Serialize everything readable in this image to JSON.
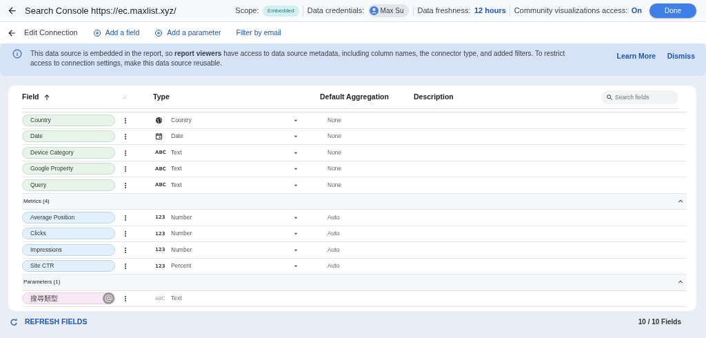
{
  "top_bar": {
    "title": "Search Console https://ec.maxlist.xyz/",
    "scope_label": "Scope:",
    "scope_badge": "Embedded",
    "credentials_label": "Data credentials:",
    "credentials_user": "Max Su",
    "freshness_label": "Data freshness:",
    "freshness_value": "12 hours",
    "community_label": "Community visualizations access:",
    "community_value": "On",
    "done_button": "Done"
  },
  "toolbar": {
    "title": "Edit Connection",
    "actions": [
      {
        "label": "Add a field",
        "kind": "add"
      },
      {
        "label": "Add a parameter",
        "kind": "add"
      },
      {
        "label": "Filter by email",
        "kind": "plain"
      }
    ]
  },
  "banner": {
    "text": "This data source is embedded in the report, so **report viewers** have access to data source metadata, including column names, the connector type, and added filters. To restrict access to connection settings, make this data source reusable.",
    "links": [
      "Learn More",
      "Dismiss"
    ]
  },
  "table": {
    "columns": [
      "Field",
      "Type",
      "Default Aggregation",
      "Description"
    ],
    "search": {
      "placeholder": "Search fields"
    },
    "sections": [
      {
        "kind": "dimension",
        "rows": [
          {
            "name": "Country",
            "type_icon": {
              "kind": "globe"
            },
            "type": "Country",
            "aggregation": "None",
            "editable": true
          },
          {
            "name": "Date",
            "type_icon": {
              "kind": "calendar"
            },
            "type": "Date",
            "aggregation": "None",
            "editable": true
          },
          {
            "name": "Device Category",
            "type_icon": {
              "kind": "label",
              "text": "ABC"
            },
            "type": "Text",
            "aggregation": "None",
            "editable": true
          },
          {
            "name": "Google Property",
            "type_icon": {
              "kind": "label",
              "text": "ABC"
            },
            "type": "Text",
            "aggregation": "None",
            "editable": true
          },
          {
            "name": "Query",
            "type_icon": {
              "kind": "label",
              "text": "ABC"
            },
            "type": "Text",
            "aggregation": "None",
            "editable": true
          }
        ]
      },
      {
        "kind": "metric",
        "header": "Metrics (4)",
        "expanded": true,
        "rows": [
          {
            "name": "Average Position",
            "type_icon": {
              "kind": "label",
              "text": "123"
            },
            "type": "Number",
            "aggregation": "Auto",
            "editable": true
          },
          {
            "name": "Clicks",
            "type_icon": {
              "kind": "label",
              "text": "123"
            },
            "type": "Number",
            "aggregation": "Auto",
            "editable": true
          },
          {
            "name": "Impressions",
            "type_icon": {
              "kind": "label",
              "text": "123"
            },
            "type": "Number",
            "aggregation": "Auto",
            "editable": true
          },
          {
            "name": "Site CTR",
            "type_icon": {
              "kind": "label",
              "text": "123"
            },
            "type": "Percent",
            "aggregation": "Auto",
            "editable": true
          }
        ]
      },
      {
        "kind": "parameter",
        "header": "Parameters (1)",
        "expanded": true,
        "rows": [
          {
            "name": "搜尋類型",
            "type_icon": {
              "kind": "label",
              "text": "ABC"
            },
            "type": "Text",
            "editable": false
          }
        ]
      }
    ]
  },
  "footer": {
    "refresh": "REFRESH FIELDS",
    "count": "10 / 10 Fields"
  }
}
